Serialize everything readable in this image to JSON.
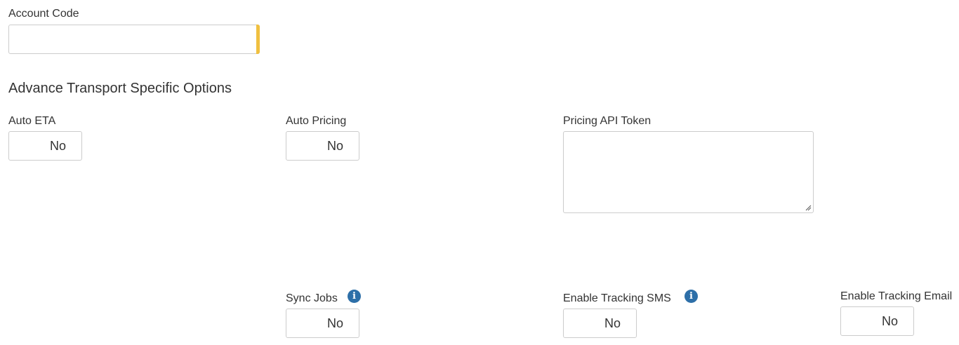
{
  "account_code": {
    "label": "Account Code",
    "value": ""
  },
  "section": {
    "title": "Advance Transport Specific Options"
  },
  "auto_eta": {
    "label": "Auto ETA",
    "value": "No"
  },
  "auto_pricing": {
    "label": "Auto Pricing",
    "value": "No"
  },
  "pricing_api_token": {
    "label": "Pricing API Token",
    "value": ""
  },
  "sync_jobs": {
    "label": "Sync Jobs",
    "value": "No",
    "info_glyph": "i"
  },
  "enable_tracking_sms": {
    "label": "Enable Tracking SMS",
    "value": "No",
    "info_glyph": "i"
  },
  "enable_tracking_email": {
    "label": "Enable Tracking Email",
    "value": "No"
  },
  "colors": {
    "required_accent": "#f0c040",
    "info_icon": "#2d6fa8",
    "border": "#cccccc",
    "text": "#333333"
  }
}
